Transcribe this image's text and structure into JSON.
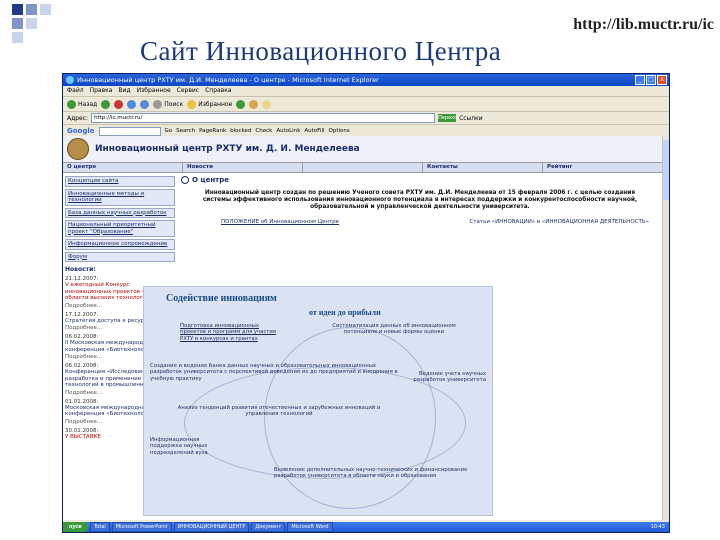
{
  "slide": {
    "url": "http://lib.muctr.ru/ic",
    "title": "Сайт Инновационного Центра",
    "decoration_colors": [
      "#1f3b8a",
      "#7f95c8",
      "#c9d3ea"
    ]
  },
  "browser": {
    "window_title": "Инновационный центр РХТУ им. Д.И. Менделеева - О центре - Microsoft Internet Explorer",
    "window_buttons": [
      "_",
      "□",
      "x"
    ],
    "menu": [
      "Файл",
      "Правка",
      "Вид",
      "Избранное",
      "Сервис",
      "Справка"
    ],
    "toolbar": {
      "back_label": "Назад",
      "search_label": "Поиск",
      "favorites_label": "Избранное"
    },
    "address_label": "Адрес:",
    "address_value": "http://ic.muctr.ru/",
    "go_label": "Переход",
    "links_label": "Ссылки",
    "google_bar": {
      "logo": "Google",
      "items": [
        "Go",
        "Search",
        "PageRank",
        "blocked",
        "Check",
        "AutoLink",
        "AutoFill",
        "Options"
      ]
    },
    "status_colors": {
      "titlebar": "#0a46c8",
      "taskbar": "#2559d6",
      "start": "#3a9a3a"
    }
  },
  "site": {
    "header_title": "Инновационный центр РХТУ им. Д. И. Менделеева",
    "nav": [
      "О центре",
      "Новости",
      "",
      "Контакты",
      "Рейтинг"
    ],
    "sidebar": [
      "Концепция сайта",
      "Инновационные методы и технологии",
      "База данных научных разработок",
      "Национальный приоритетный проект \"Образование\"",
      "Информационное сопровождение",
      "Форум"
    ],
    "news_heading": "Новости:",
    "news": [
      {
        "date": "21.12.2007:",
        "text": "V ежегодный Конкурс инновационных проектов «Лидер в области высоких технологий»",
        "more": "Подробнее..."
      },
      {
        "date": "17.12.2007:",
        "text": "Стратегия доступа к ресурсам РГБ",
        "more": "Подробнее..."
      },
      {
        "date": "06.02.2008:",
        "text": "II Московская международная конференция «Биотехнология 2008»",
        "more": "Подробнее..."
      },
      {
        "date": "06.02.2008:",
        "text": "Конференция «Исследование, разработка и применение высоких технологий в промышленности»",
        "more": "Подробнее..."
      },
      {
        "date": "01.01.2008:",
        "text": "Московская международная конференция «Биотехнология 2008»",
        "more": "Подробнее..."
      },
      {
        "date": "30.01.2008:",
        "text": "У ВЫСТАВКЕ",
        "more": ""
      }
    ],
    "main_heading": "О центре",
    "intro": "Инновационный центр создан по решению Ученого совета РХТУ им. Д.И. Менделеева от 15 февраля 2006 г. с целью создания системы эффективного использования инновационного потенциала в интересах поддержки и конкурентоспособности научной, образовательной и управленческой деятельности университета.",
    "link_left": "ПОЛОЖЕНИЕ об Инновационном Центре",
    "link_right": "Статьи «ИННОВАЦИИ» в «ИННОВАЦИОННАЯ ДЕЯТЕЛЬНОСТЬ»",
    "diagram": {
      "title": "Содействие инновациям",
      "subtitle": "от идеи до прибыли",
      "blocks": [
        "Подготовка инновационных проектов и программ для участия РХТУ в конкурсах и грантах",
        "Систематизация данных об инновационном потенциале и новые формы оценки",
        "Создание и ведение Банка данных научных и образовательных инновационных разработок университета с перспективой доведения их до предприятий и внедрения в учебную практику",
        "Ведение учета научных разработок университета",
        "Анализ тенденций развития отечественных и зарубежных инноваций и управления технологий",
        "Информационная поддержка научных подразделений вуза",
        "Выявление дополнительных научно-технических и финансирование разработок университета в области науки и образования"
      ]
    }
  },
  "taskbar": {
    "start": "пуск",
    "tasks": [
      "Total",
      "Microsoft PowerPoint",
      "ИННОВАЦИОННЫЙ ЦЕНТР",
      "Документ",
      "Microsoft Word"
    ],
    "clock": "10:43"
  }
}
